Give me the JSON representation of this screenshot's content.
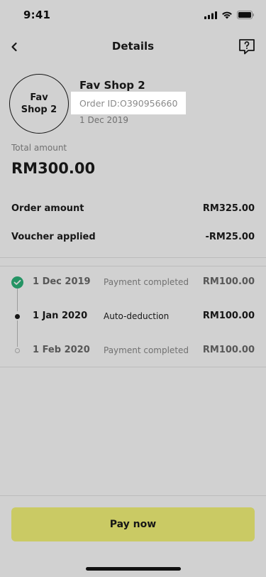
{
  "status_bar": {
    "time": "9:41"
  },
  "nav": {
    "title": "Details",
    "back_icon": "chevron-left-icon",
    "help_icon": "help-chat-icon"
  },
  "shop": {
    "logo_text": "Fav Shop 2",
    "name": "Fav Shop 2",
    "order_id": "Order ID:O390956660",
    "date": "1 Dec 2019"
  },
  "total": {
    "label": "Total amount",
    "amount": "RM300.00"
  },
  "breakdown": [
    {
      "label": "Order amount",
      "value": "RM325.00"
    },
    {
      "label": "Voucher applied",
      "value": "-RM25.00"
    }
  ],
  "installments": [
    {
      "date": "1 Dec 2019",
      "status": "Payment completed",
      "amount": "RM100.00",
      "state": "completed",
      "icon": "check-circle-icon"
    },
    {
      "date": "1 Jan 2020",
      "status": "Auto-deduction",
      "amount": "RM100.00",
      "state": "current",
      "icon": "filled-dot-icon"
    },
    {
      "date": "1 Feb 2020",
      "status": "Payment completed",
      "amount": "RM100.00",
      "state": "upcoming",
      "icon": "hollow-dot-icon"
    }
  ],
  "footer": {
    "pay_label": "Pay now"
  },
  "colors": {
    "accent": "#f7f77a",
    "success": "#2db57b",
    "text": "#1c1c1c",
    "muted": "#8a8a8a"
  }
}
